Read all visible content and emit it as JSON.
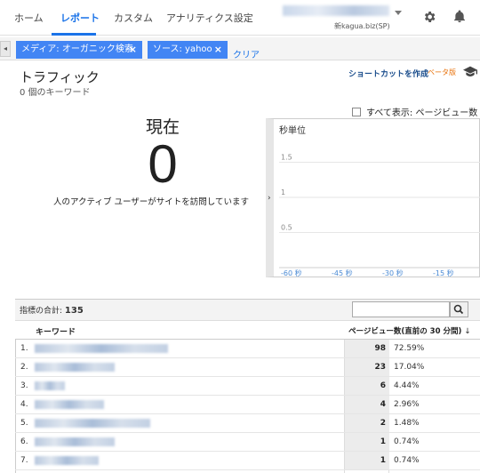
{
  "nav": {
    "items": [
      "ホーム",
      "レポート",
      "カスタム",
      "アナリティクス設定"
    ],
    "active_index": 1,
    "account_subtitle": "新kagua.biz(SP)"
  },
  "segments": {
    "chips": [
      {
        "label": "メディア: オーガニック検索",
        "close": "×"
      },
      {
        "label": "ソース: yahoo",
        "close": "×"
      }
    ],
    "clear_label": "クリア",
    "collapse_glyph": "◂"
  },
  "header": {
    "title": "トラフィック",
    "subtitle": "0 個のキーワード",
    "shortcut_label": "ショートカットを作成",
    "beta_label": "ベータ版"
  },
  "realtime": {
    "now_label": "現在",
    "active_count": "0",
    "active_text": "人のアクティブ ユーザーがサイトを訪問しています",
    "show_all_label": "すべて表示: ページビュー数",
    "chart_unit_label": "秒単位",
    "expand_glyph": "›"
  },
  "chart_data": {
    "type": "bar",
    "ylabel": "秒単位",
    "yticks": [
      "1.5",
      "1",
      "0.5"
    ],
    "xticks": [
      "-60 秒",
      "-45 秒",
      "-30 秒",
      "-15 秒"
    ],
    "ylim": [
      0,
      2
    ],
    "values": []
  },
  "table": {
    "metric_total_label": "指標の合計:",
    "metric_total_value": "135",
    "col_keyword": "キーワード",
    "col_pageviews": "ページビュー数(直前の 30 分間)",
    "sort_glyph": "↓",
    "rows": [
      {
        "idx": "1.",
        "value": "98",
        "pct": "72.59%"
      },
      {
        "idx": "2.",
        "value": "23",
        "pct": "17.04%"
      },
      {
        "idx": "3.",
        "value": "6",
        "pct": "4.44%"
      },
      {
        "idx": "4.",
        "value": "4",
        "pct": "2.96%"
      },
      {
        "idx": "5.",
        "value": "2",
        "pct": "1.48%"
      },
      {
        "idx": "6.",
        "value": "1",
        "pct": "0.74%"
      },
      {
        "idx": "7.",
        "value": "1",
        "pct": "0.74%"
      }
    ]
  },
  "colors": {
    "accent": "#1a73e8",
    "chip": "#4285f4",
    "beta": "#e8710a"
  }
}
